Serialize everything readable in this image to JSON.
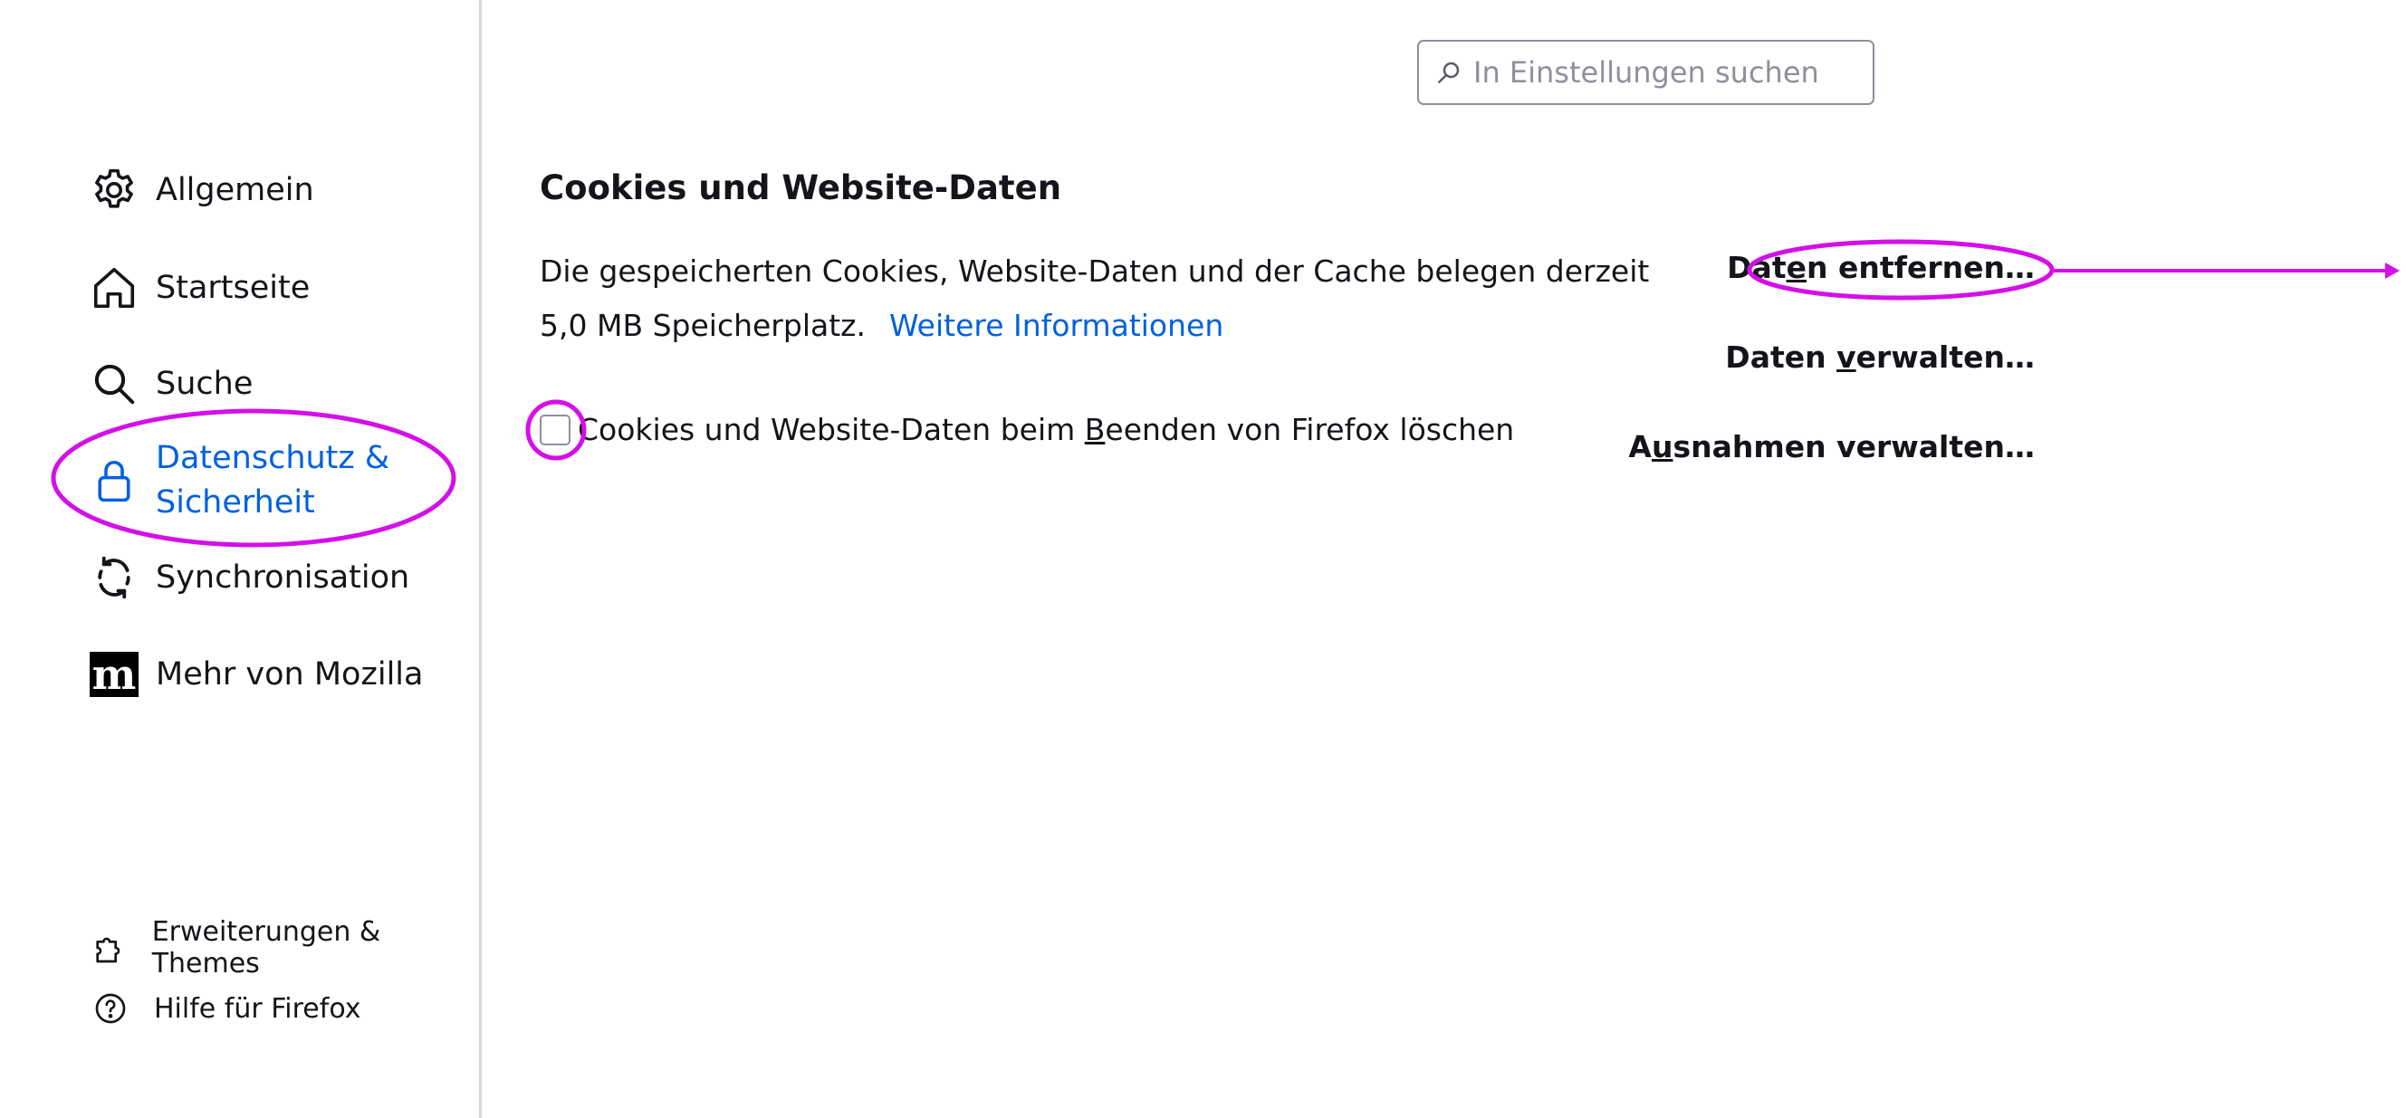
{
  "search": {
    "placeholder": "In Einstellungen suchen"
  },
  "sidebar": {
    "items": [
      {
        "label": "Allgemein",
        "icon": "gear-icon"
      },
      {
        "label": "Startseite",
        "icon": "home-icon"
      },
      {
        "label": "Suche",
        "icon": "search-icon"
      },
      {
        "label": "Datenschutz & Sicherheit",
        "icon": "lock-icon",
        "selected": true
      },
      {
        "label": "Synchronisation",
        "icon": "sync-icon"
      },
      {
        "label": "Mehr von Mozilla",
        "icon": "mozilla-icon"
      }
    ],
    "footer": [
      {
        "label": "Erweiterungen & Themes",
        "icon": "puzzle-icon"
      },
      {
        "label": "Hilfe für Firefox",
        "icon": "help-icon"
      }
    ]
  },
  "cookies": {
    "title": "Cookies und Website-Daten",
    "description": "Die gespeicherten Cookies, Website-Daten und der Cache belegen derzeit 5,0 MB Speicherplatz.",
    "learn_more": "Weitere Informationen",
    "delete_on_close": {
      "label_before": "Cookies und Website-Daten beim ",
      "label_access_key": "B",
      "label_after": "eenden von Firefox löschen",
      "checked": false
    },
    "buttons": {
      "clear_data": {
        "before": "Dat",
        "key": "e",
        "after": "n entfernen…"
      },
      "manage_data": {
        "before": "Daten ",
        "key": "v",
        "after": "erwalten…"
      },
      "manage_exceptions": {
        "before": "A",
        "key": "u",
        "after": "snahmen verwalten…"
      }
    }
  },
  "colors": {
    "accent": "#0061e0",
    "annotation": "#d40fe8",
    "text": "#15141a"
  }
}
